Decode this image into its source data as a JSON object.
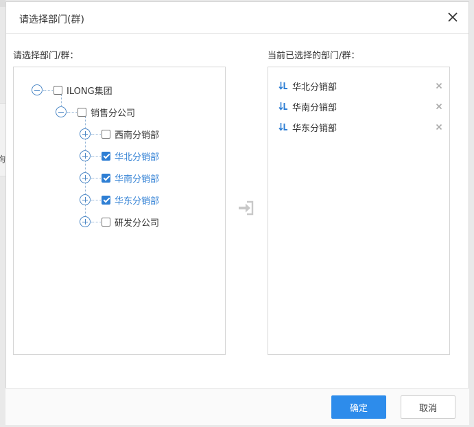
{
  "dialog": {
    "title": "请选择部门(群)",
    "left_label": "请选择部门/群：",
    "right_label": "当前已选择的部门/群：",
    "background_fragment": "询"
  },
  "tree": {
    "root": {
      "label": "ILONG集团",
      "expanded": true,
      "checked": false
    },
    "child": {
      "label": "销售分公司",
      "expanded": true,
      "checked": false
    },
    "leaves": [
      {
        "label": "西南分销部",
        "checked": false
      },
      {
        "label": "华北分销部",
        "checked": true
      },
      {
        "label": "华南分销部",
        "checked": true
      },
      {
        "label": "华东分销部",
        "checked": true
      },
      {
        "label": "研发分公司",
        "checked": false
      }
    ]
  },
  "selected": [
    {
      "label": "华北分销部"
    },
    {
      "label": "华南分销部"
    },
    {
      "label": "华东分销部"
    }
  ],
  "buttons": {
    "ok": "确定",
    "cancel": "取消"
  },
  "icons": {
    "close": "close-icon",
    "transfer": "transfer-right-icon",
    "sort": "sort-down-icon",
    "remove": "remove-x-icon"
  },
  "colors": {
    "primary": "#2d8ceb",
    "selected_text": "#2f7fd4",
    "tree_line": "#4a86c5"
  }
}
